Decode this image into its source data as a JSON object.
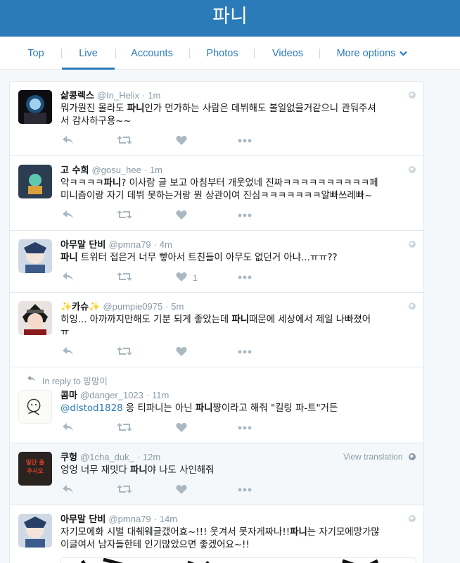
{
  "header": {
    "title": "파니"
  },
  "tabs": [
    {
      "label": "Top",
      "active": false
    },
    {
      "label": "Live",
      "active": true
    },
    {
      "label": "Accounts",
      "active": false
    },
    {
      "label": "Photos",
      "active": false
    },
    {
      "label": "Videos",
      "active": false
    },
    {
      "label": "More options",
      "active": false
    }
  ],
  "tweets": [
    {
      "name": "삶콩렉스",
      "handle": "@In_Helix",
      "time": "· 1m",
      "line1": [
        "뭐가뭔진 몰라도 ",
        "파니",
        "인가 먼가하는 사람은 데뷔해도 볼일없을거같으니 관둬주셔"
      ],
      "line2": "서 감사하구용~~",
      "likes": ""
    },
    {
      "name": "고 수희",
      "handle": "@gosu_hee",
      "time": "· 1m",
      "line1": [
        "악ㅋㅋㅋㅋ",
        "파니",
        "? 이사람 글 보고 아침부터 개웃었네 진짜ㅋㅋㅋㅋㅋㅋㅋㅋㅋㅋ페"
      ],
      "line2": "미니즘이랑 자기 데뷔 못하는거랑 뭔 상관이여 진심ㅋㅋㅋㅋㅋㅋㅋ알빠쓰레빠~",
      "likes": ""
    },
    {
      "name": "아무말 단비",
      "handle": "@pmna79",
      "time": "· 4m",
      "line1": [
        "",
        "파니",
        " 트위터 접은거 너무 빻아서 트친들이 아무도 없던거 아냐...ㅠㅠ??"
      ],
      "line2": "",
      "likes": "1"
    },
    {
      "name": "✨카슈✨",
      "handle": "@pumpie0975",
      "time": "· 5m",
      "line1": [
        "히잉... 아까까지만해도 기분 되게 좋았는데 ",
        "파니",
        "때문에 세상에서 제일 나빠졌어"
      ],
      "line2": "ㅠ",
      "likes": ""
    },
    {
      "reply_to": "In reply to 망망이",
      "name": "콤마",
      "handle": "@danger_1023",
      "time": "· 11m",
      "mention": "@dlstod1828",
      "line1": [
        " 응 티파니는 아닌 ",
        "파니",
        "쨩이라고 해줘 \"킬링 파-트\"거든"
      ],
      "line2": "",
      "likes": ""
    },
    {
      "name": "쿠헝",
      "handle": "@1cha_duk_",
      "time": "· 12m",
      "view_translation": "View translation",
      "line1": [
        "엉엉 너무 재밋다 ",
        "파니",
        "야 나도 사인해줘"
      ],
      "line2": "",
      "likes": "",
      "avatar_text": "일단 출\n추시오"
    },
    {
      "name": "아무말 단비",
      "handle": "@pmna79",
      "time": "· 14m",
      "line1": [
        "자기모에화 시벌 대췌웨글갰어효~!!! 웃겨서 못자게짜나!!",
        "파니",
        "는 자기모에망가많"
      ],
      "line2": "이글여서 남자들한테 인기많았으면 좋겠어요~!!",
      "likes": ""
    }
  ],
  "colors": {
    "brand": "#2b7bb9",
    "muted": "#8899a6",
    "border": "#e1e8ed",
    "bg": "#f5f8fa"
  },
  "icons": [
    "reply-icon",
    "retweet-icon",
    "like-icon",
    "more-icon",
    "globe-icon",
    "chevron-down-icon"
  ]
}
